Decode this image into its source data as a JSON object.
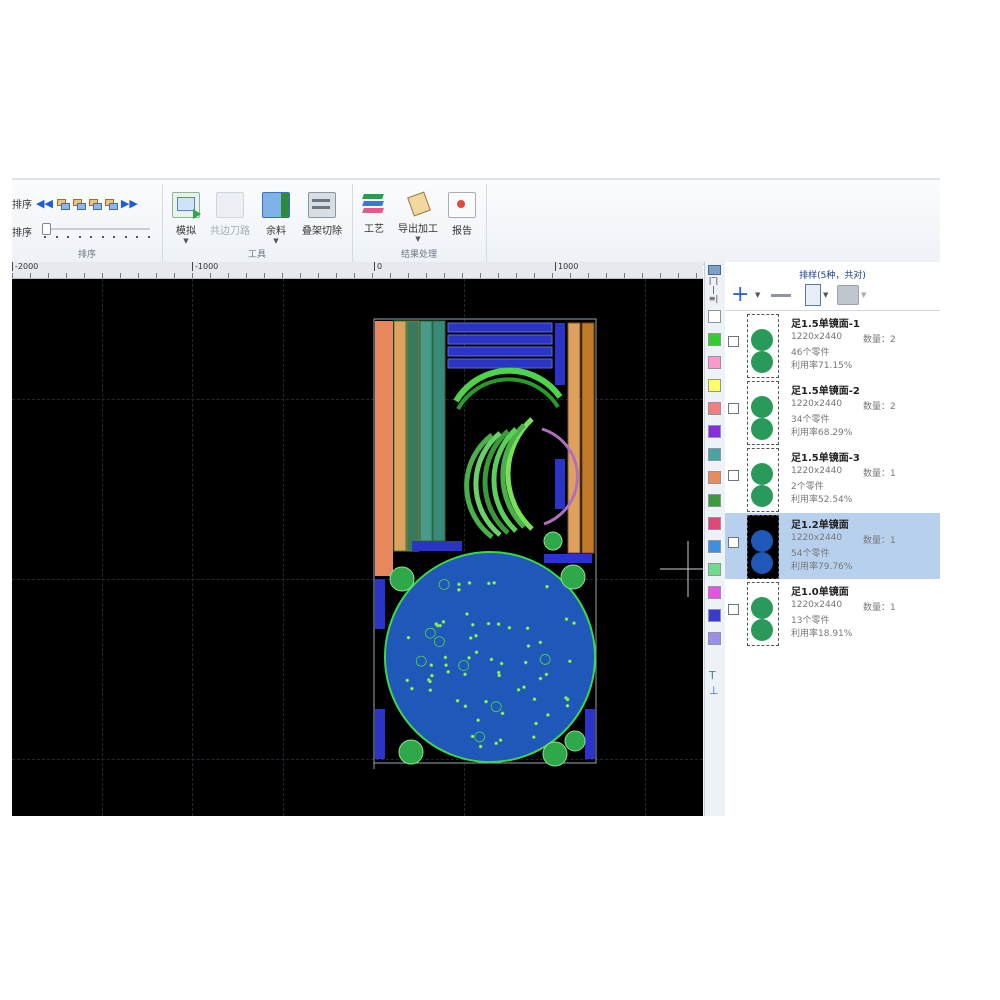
{
  "ribbon": {
    "sort_group": {
      "label": "排序",
      "row1_label": "排序",
      "row2_label": "排序"
    },
    "tools_group": {
      "label": "工具",
      "simulate": "模拟",
      "common_edge": "共边刀路",
      "remnant": "余料",
      "stack_cut": "叠架切除"
    },
    "result_group": {
      "label": "结果处理",
      "process": "工艺",
      "export": "导出加工",
      "report": "报告"
    }
  },
  "ruler": {
    "labels": [
      "-2000",
      "-1000",
      "0",
      "1000"
    ]
  },
  "color_strip": {
    "top_icon": "layer-icon",
    "text_icon_label": "T",
    "bottom_icon_label": "⊥",
    "colors": [
      "#ffffff",
      "#32cd32",
      "#ff99cc",
      "#ffff66",
      "#f08080",
      "#8a2be2",
      "#4aa3a0",
      "#e98b5a",
      "#3c9a3c",
      "#e0457b",
      "#3f8fe0",
      "#6fdc8c",
      "#e255e2",
      "#3a3ad0",
      "#9c8fe8"
    ]
  },
  "panel": {
    "title": "排样(5种，共对)",
    "items": [
      {
        "name": "足1.5单镜面-1",
        "size": "1220x2440",
        "qty": "数量：2",
        "parts": "46个零件",
        "rate": "利用率71.15%",
        "selected": false
      },
      {
        "name": "足1.5单镜面-2",
        "size": "1220x2440",
        "qty": "数量：2",
        "parts": "34个零件",
        "rate": "利用率68.29%",
        "selected": false
      },
      {
        "name": "足1.5单镜面-3",
        "size": "1220x2440",
        "qty": "数量：1",
        "parts": "2个零件",
        "rate": "利用率52.54%",
        "selected": false
      },
      {
        "name": "足1.2单镜面",
        "size": "1220x2440",
        "qty": "数量：1",
        "parts": "54个零件",
        "rate": "利用率79.76%",
        "selected": true
      },
      {
        "name": "足1.0单镜面",
        "size": "1220x2440",
        "qty": "数量：1",
        "parts": "13个零件",
        "rate": "利用率18.91%",
        "selected": false
      }
    ]
  },
  "colors": {
    "canvas_bg": "#000000",
    "part_blue": "#1f58b8",
    "part_green": "#1fbf3a",
    "part_orange": "#e8865e",
    "selection": "#b7d0ee",
    "accent": "#2b63d9"
  }
}
